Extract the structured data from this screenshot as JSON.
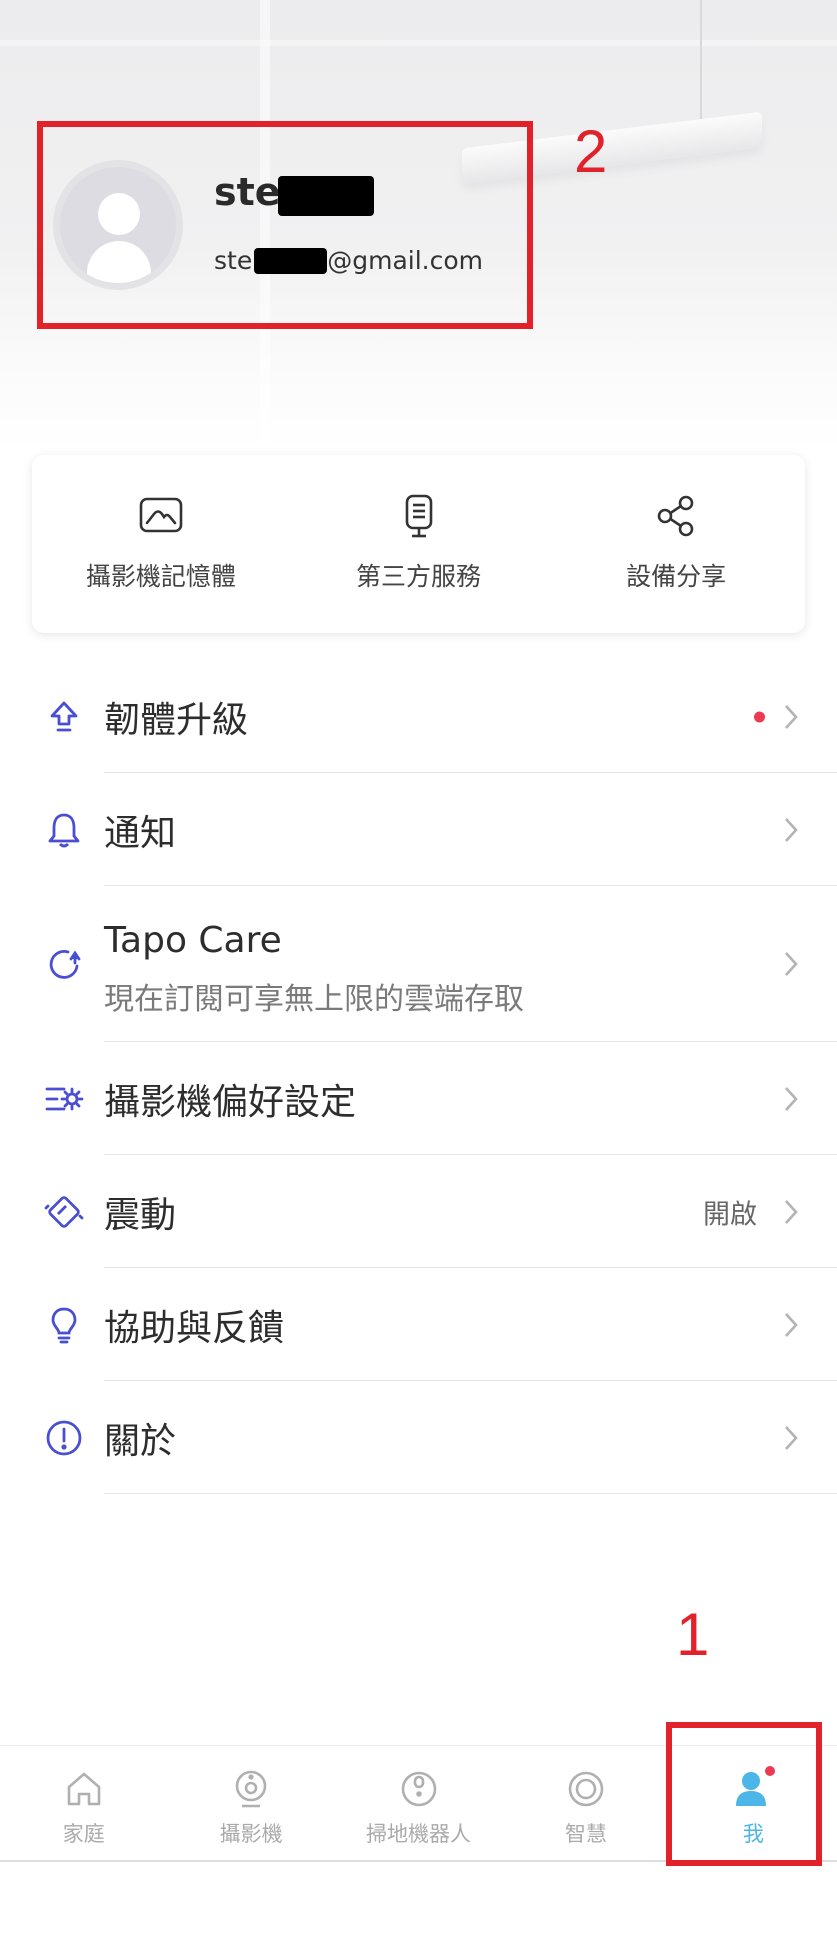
{
  "profile": {
    "username_visible": "ste",
    "email_prefix": "ste",
    "email_suffix": "@gmail.com"
  },
  "annotations": {
    "label_1": "1",
    "label_2": "2",
    "color": "#e2222a"
  },
  "quick_actions": [
    {
      "label": "攝影機記憶體",
      "icon": "photo-storage-icon"
    },
    {
      "label": "第三方服務",
      "icon": "smart-speaker-icon"
    },
    {
      "label": "設備分享",
      "icon": "share-icon"
    }
  ],
  "menu": {
    "firmware": {
      "label": "韌體升級",
      "icon": "upgrade-arrow-icon",
      "has_badge": true
    },
    "notifications": {
      "label": "通知",
      "icon": "bell-icon"
    },
    "tapo_care": {
      "label": "Tapo Care",
      "subtitle": "現在訂閱可享無上限的雲端存取",
      "icon": "cloud-refresh-icon"
    },
    "camera_prefs": {
      "label": "攝影機偏好設定",
      "icon": "settings-list-icon"
    },
    "vibration": {
      "label": "震動",
      "value": "開啟",
      "icon": "vibration-icon"
    },
    "help": {
      "label": "協助與反饋",
      "icon": "lightbulb-icon"
    },
    "about": {
      "label": "關於",
      "icon": "info-icon"
    }
  },
  "bottom_nav": [
    {
      "label": "家庭",
      "icon": "home-icon",
      "active": false
    },
    {
      "label": "攝影機",
      "icon": "camera-icon",
      "active": false
    },
    {
      "label": "掃地機器人",
      "icon": "robot-vacuum-icon",
      "active": false
    },
    {
      "label": "智慧",
      "icon": "smart-icon",
      "active": false
    },
    {
      "label": "我",
      "icon": "profile-icon",
      "active": true
    }
  ],
  "colors": {
    "accent": "#4a4fd1",
    "nav_active": "#4cb6e8",
    "badge": "#ec3a52"
  }
}
